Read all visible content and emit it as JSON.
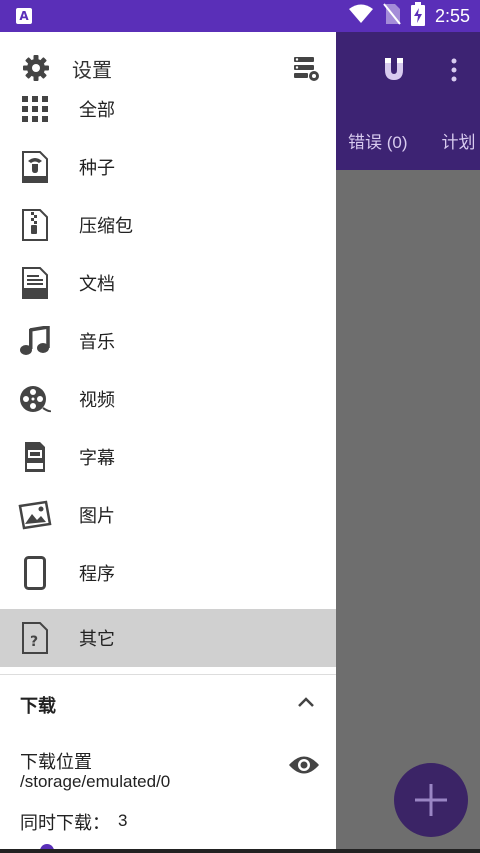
{
  "status_bar": {
    "time": "2:55",
    "app_badge": "A",
    "icons": [
      "wifi-icon",
      "no-sim-icon",
      "battery-charging-icon"
    ]
  },
  "background_app": {
    "tabs": [
      "错误 (0)",
      "计划"
    ],
    "toolbar_icons": [
      "magnet-icon",
      "more-vert-icon"
    ],
    "fab_icon": "add-icon"
  },
  "drawer": {
    "title": "设置",
    "header_icons": [
      "gear-icon",
      "settings-list-icon"
    ],
    "categories": [
      {
        "label": "全部",
        "icon": "grid-icon"
      },
      {
        "label": "种子",
        "icon": "torrent-file-icon"
      },
      {
        "label": "压缩包",
        "icon": "archive-file-icon"
      },
      {
        "label": "文档",
        "icon": "doc-file-icon"
      },
      {
        "label": "音乐",
        "icon": "music-note-icon"
      },
      {
        "label": "视频",
        "icon": "film-reel-icon"
      },
      {
        "label": "字幕",
        "icon": "subtitle-file-icon"
      },
      {
        "label": "图片",
        "icon": "image-icon"
      },
      {
        "label": "程序",
        "icon": "phone-icon"
      },
      {
        "label": "其它",
        "icon": "unknown-file-icon"
      }
    ],
    "selected_category": "其它",
    "download_section": {
      "header": "下载",
      "location_label": "下载位置",
      "location_path": "/storage/emulated/0",
      "simultaneous_label": "同时下载：",
      "simultaneous_value": "3"
    }
  },
  "colors": {
    "status_bar": "#5a2fb8",
    "app_bar": "#3d2373",
    "scrim": "#6e6e6e",
    "selected_item": "#d0d0d0",
    "icon": "#444444"
  }
}
